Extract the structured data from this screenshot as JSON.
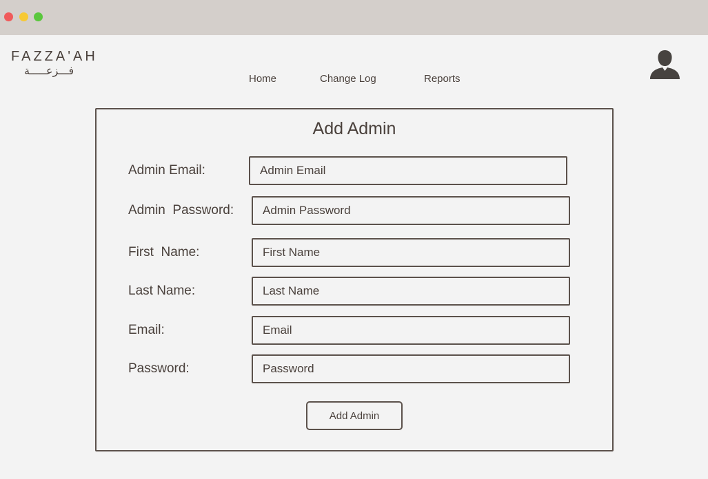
{
  "window": {
    "controls": [
      {
        "name": "close",
        "color": "#f05a5a"
      },
      {
        "name": "minimize",
        "color": "#f7c934"
      },
      {
        "name": "maximize",
        "color": "#5ac73d"
      }
    ]
  },
  "header": {
    "logo_latin": "FAZZA'AH",
    "logo_arabic": "فـــزعـــــة",
    "nav": {
      "home": "Home",
      "change_log": "Change Log",
      "reports": "Reports"
    },
    "user_icon": "user-icon"
  },
  "form": {
    "title": "Add Admin",
    "fields": [
      {
        "label": "Admin Email:",
        "placeholder": "Admin Email"
      },
      {
        "label": "Admin  Password:",
        "placeholder": "Admin Password"
      },
      {
        "label": "First  Name:",
        "placeholder": "First Name"
      },
      {
        "label": "Last Name:",
        "placeholder": "Last Name"
      },
      {
        "label": "Email:",
        "placeholder": "Email"
      },
      {
        "label": "Password:",
        "placeholder": "Password"
      }
    ],
    "submit_label": "Add Admin"
  },
  "colors": {
    "background": "#f3f3f3",
    "titlebar": "#d4cfcb",
    "text": "#4a413c",
    "border": "#5b514b"
  }
}
